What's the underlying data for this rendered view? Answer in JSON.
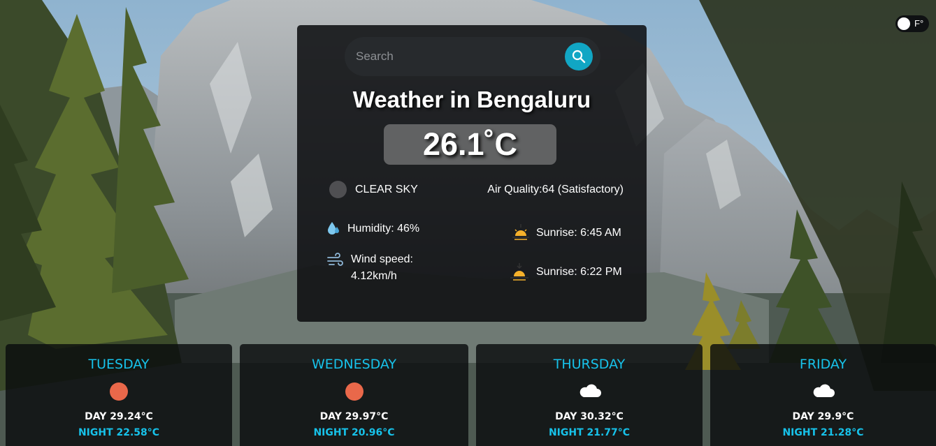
{
  "unit_toggle": {
    "label": "F°"
  },
  "search": {
    "placeholder": "Search"
  },
  "weather": {
    "title": "Weather in Bengaluru",
    "temperature": "26.1˚C",
    "condition": "CLEAR SKY",
    "air_quality": "Air Quality:64 (Satisfactory)",
    "humidity": "Humidity: 46%",
    "wind_label": "Wind speed:",
    "wind_value": "4.12km/h",
    "sunrise": "Sunrise: 6:45 AM",
    "sunset": "Sunrise: 6:22 PM"
  },
  "forecast": [
    {
      "day": "TUESDAY",
      "icon": "sun-icon",
      "day_temp": "DAY 29.24°C",
      "night_temp": "NIGHT 22.58°C"
    },
    {
      "day": "WEDNESDAY",
      "icon": "sun-icon",
      "day_temp": "DAY 29.97°C",
      "night_temp": "NIGHT 20.96°C"
    },
    {
      "day": "THURSDAY",
      "icon": "cloud-icon",
      "day_temp": "DAY 30.32°C",
      "night_temp": "NIGHT 21.77°C"
    },
    {
      "day": "FRIDAY",
      "icon": "cloud-icon",
      "day_temp": "DAY 29.9°C",
      "night_temp": "NIGHT 21.28°C"
    }
  ],
  "colors": {
    "accent": "#11a6c4",
    "forecast_day": "#17c2ea",
    "sun": "#e9684a",
    "card_bg": "#0a0c0e"
  }
}
